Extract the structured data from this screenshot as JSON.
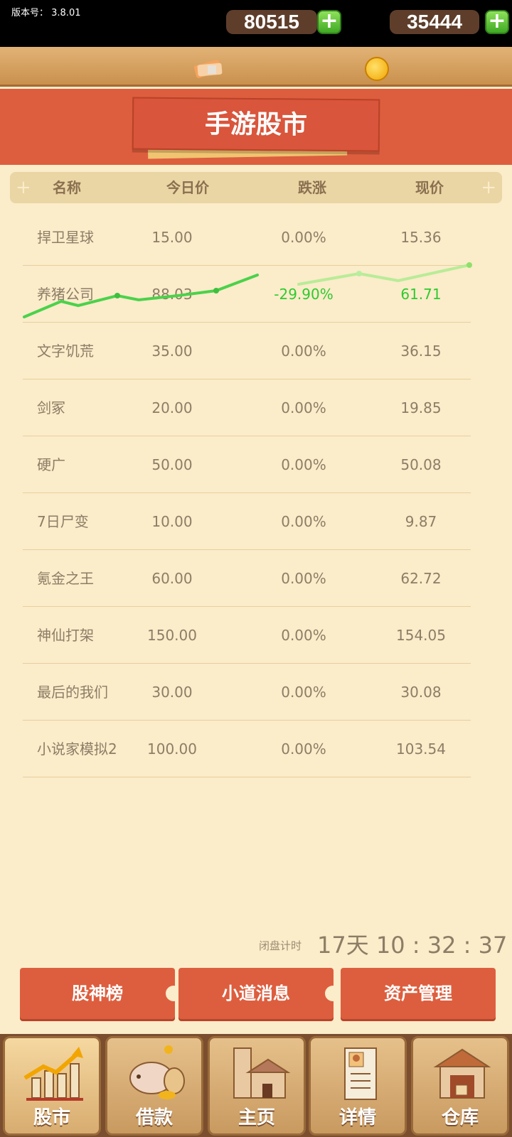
{
  "status": {
    "version_label": "版本号： 3.8.01"
  },
  "currency": {
    "cash": "80515",
    "coins": "35444",
    "plus": "+"
  },
  "header": {
    "title": "手游股市"
  },
  "table": {
    "columns": [
      "名称",
      "今日价",
      "跌涨",
      "现价"
    ],
    "rows": [
      {
        "name": "捍卫星球",
        "today": "15.00",
        "change": "0.00%",
        "current": "15.36"
      },
      {
        "name": "养猪公司",
        "today": "88.03",
        "change": "-29.90%",
        "current": "61.71"
      },
      {
        "name": "文字饥荒",
        "today": "35.00",
        "change": "0.00%",
        "current": "36.15"
      },
      {
        "name": "剑冢",
        "today": "20.00",
        "change": "0.00%",
        "current": "19.85"
      },
      {
        "name": "硬广",
        "today": "50.00",
        "change": "0.00%",
        "current": "50.08"
      },
      {
        "name": "7日尸变",
        "today": "10.00",
        "change": "0.00%",
        "current": "9.87"
      },
      {
        "name": "氪金之王",
        "today": "60.00",
        "change": "0.00%",
        "current": "62.72"
      },
      {
        "name": "神仙打架",
        "today": "150.00",
        "change": "0.00%",
        "current": "154.05"
      },
      {
        "name": "最后的我们",
        "today": "30.00",
        "change": "0.00%",
        "current": "30.08"
      },
      {
        "name": "小说家模拟2",
        "today": "100.00",
        "change": "0.00%",
        "current": "103.54"
      }
    ]
  },
  "countdown": {
    "label": "闭盘计时",
    "value": "17天 10 : 32 : 37"
  },
  "actions": {
    "ranking": "股神榜",
    "news": "小道消息",
    "assets": "资产管理"
  },
  "nav": {
    "stock": "股市",
    "loan": "借款",
    "home": "主页",
    "details": "详情",
    "warehouse": "仓库"
  },
  "colors": {
    "accent": "#dd5e3e",
    "background": "#fbecca",
    "positive": "#2ecb2e"
  }
}
